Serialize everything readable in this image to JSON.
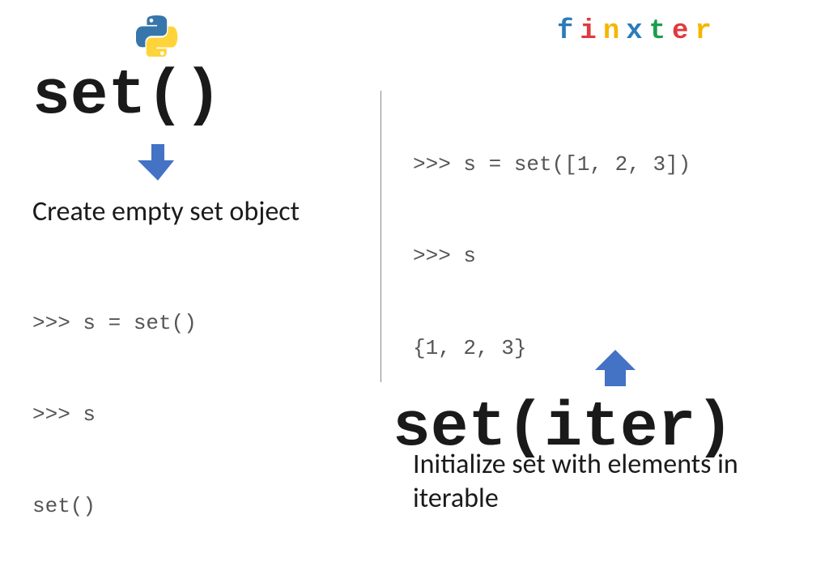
{
  "logo": {
    "brand_letters": [
      "f",
      "i",
      "n",
      "x",
      "t",
      "e",
      "r"
    ]
  },
  "left": {
    "heading_code": "set()",
    "description": "Create empty set object",
    "code_lines": [
      ">>> s = set()",
      ">>> s",
      "set()"
    ]
  },
  "right": {
    "code_lines": [
      ">>> s = set([1, 2, 3])",
      ">>> s",
      "{1, 2, 3}"
    ],
    "description": "Initialize set with elements in iterable",
    "heading_code": "set(iter)"
  },
  "colors": {
    "arrow": "#4472c4"
  }
}
